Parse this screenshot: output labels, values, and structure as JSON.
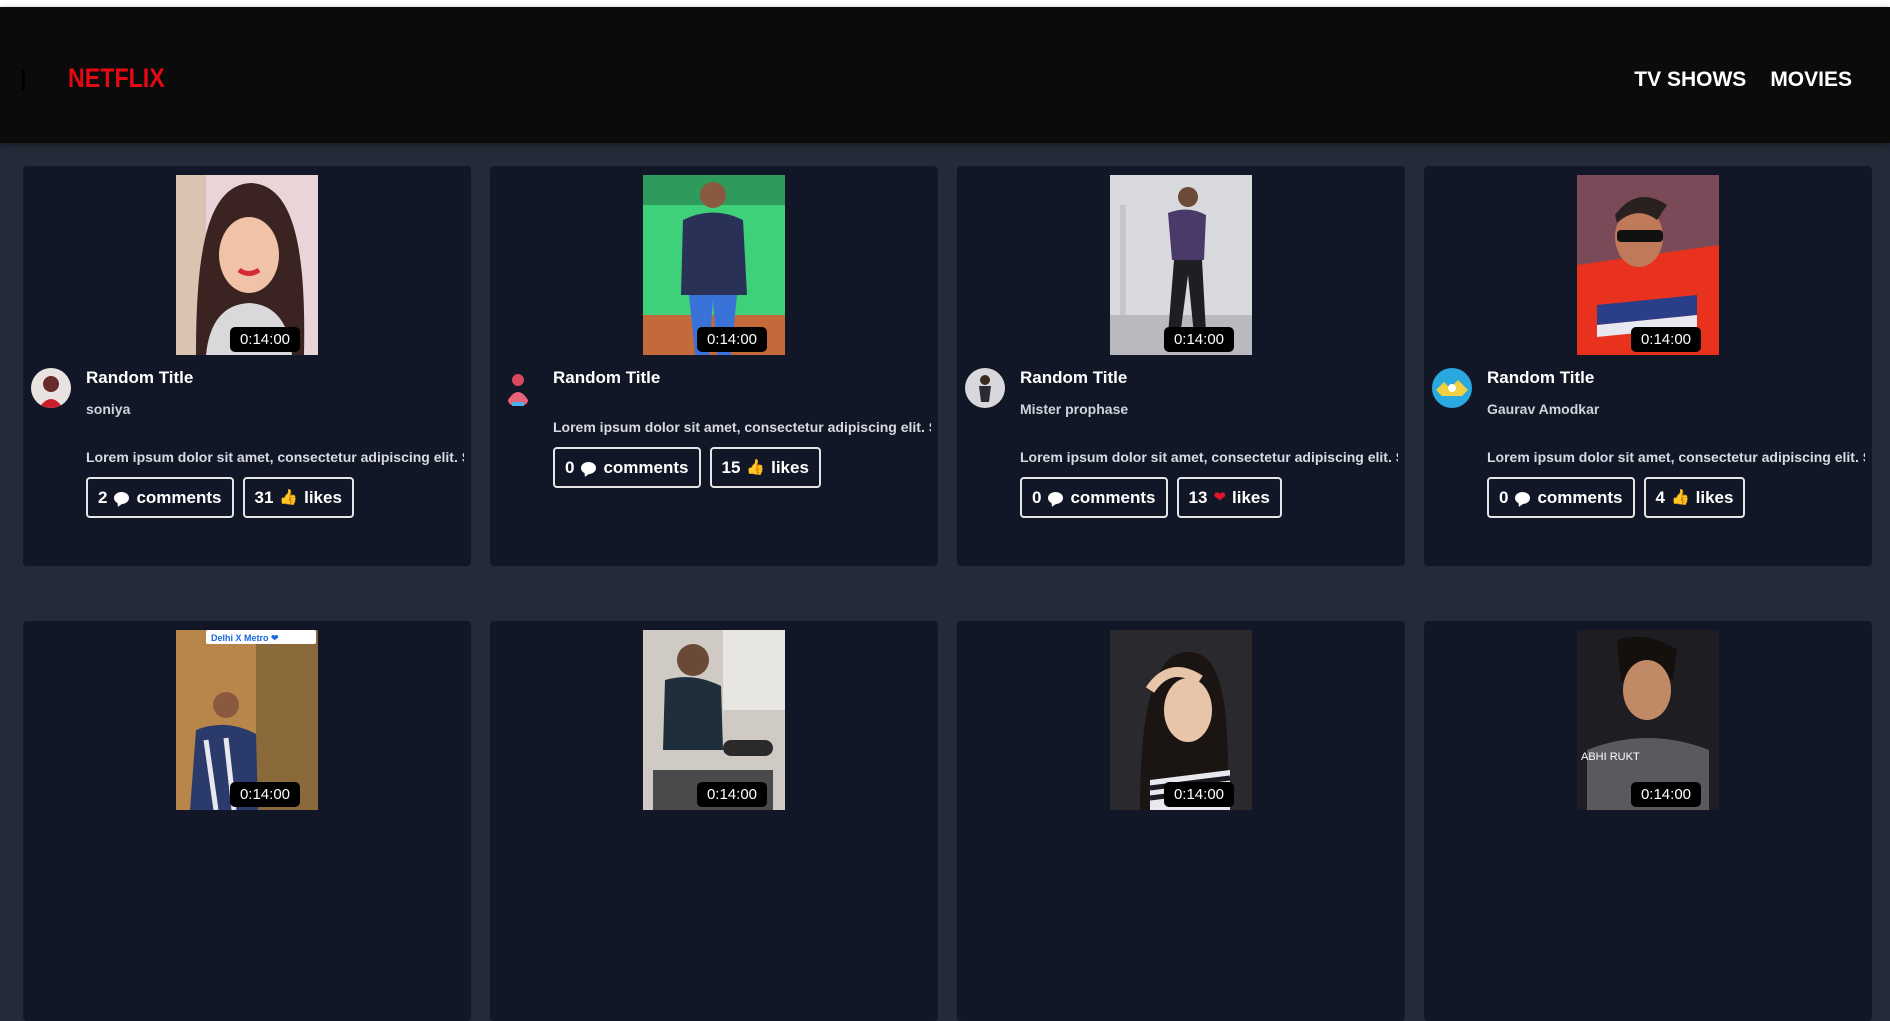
{
  "navbar": {
    "logo": "NETFLIX",
    "links": [
      "TV SHOWS",
      "MOVIES"
    ]
  },
  "colors": {
    "brand": "#e50914",
    "background": "#232a38",
    "card": "#111726"
  },
  "cards": [
    {
      "title": "Random Title",
      "author": "soniya",
      "duration": "0:14:00",
      "description": "Lorem ipsum dolor sit amet, consectetur adipiscing elit. Sed do eiusmod",
      "comments": "2",
      "comments_label": "comments",
      "likes": "31",
      "likes_label": "likes",
      "like_icon": "thumbs-up"
    },
    {
      "title": "Random Title",
      "author": "",
      "duration": "0:14:00",
      "description": "Lorem ipsum dolor sit amet, consectetur adipiscing elit. Sed do eiusmod",
      "comments": "0",
      "comments_label": "comments",
      "likes": "15",
      "likes_label": "likes",
      "like_icon": "thumbs-up"
    },
    {
      "title": "Random Title",
      "author": "Mister prophase",
      "duration": "0:14:00",
      "description": "Lorem ipsum dolor sit amet, consectetur adipiscing elit. Sed do eiusmod",
      "comments": "0",
      "comments_label": "comments",
      "likes": "13",
      "likes_label": "likes",
      "like_icon": "heart"
    },
    {
      "title": "Random Title",
      "author": "Gaurav Amodkar",
      "duration": "0:14:00",
      "description": "Lorem ipsum dolor sit amet, consectetur adipiscing elit. Sed do eiusmod",
      "comments": "0",
      "comments_label": "comments",
      "likes": "4",
      "likes_label": "likes",
      "like_icon": "thumbs-up"
    }
  ],
  "row2": [
    {
      "duration": "0:14:00",
      "overlay_text": "Delhi X Metro"
    },
    {
      "duration": "0:14:00"
    },
    {
      "duration": "0:14:00"
    },
    {
      "duration": "0:14:00",
      "overlay_text": "ABHI RUKT"
    }
  ]
}
